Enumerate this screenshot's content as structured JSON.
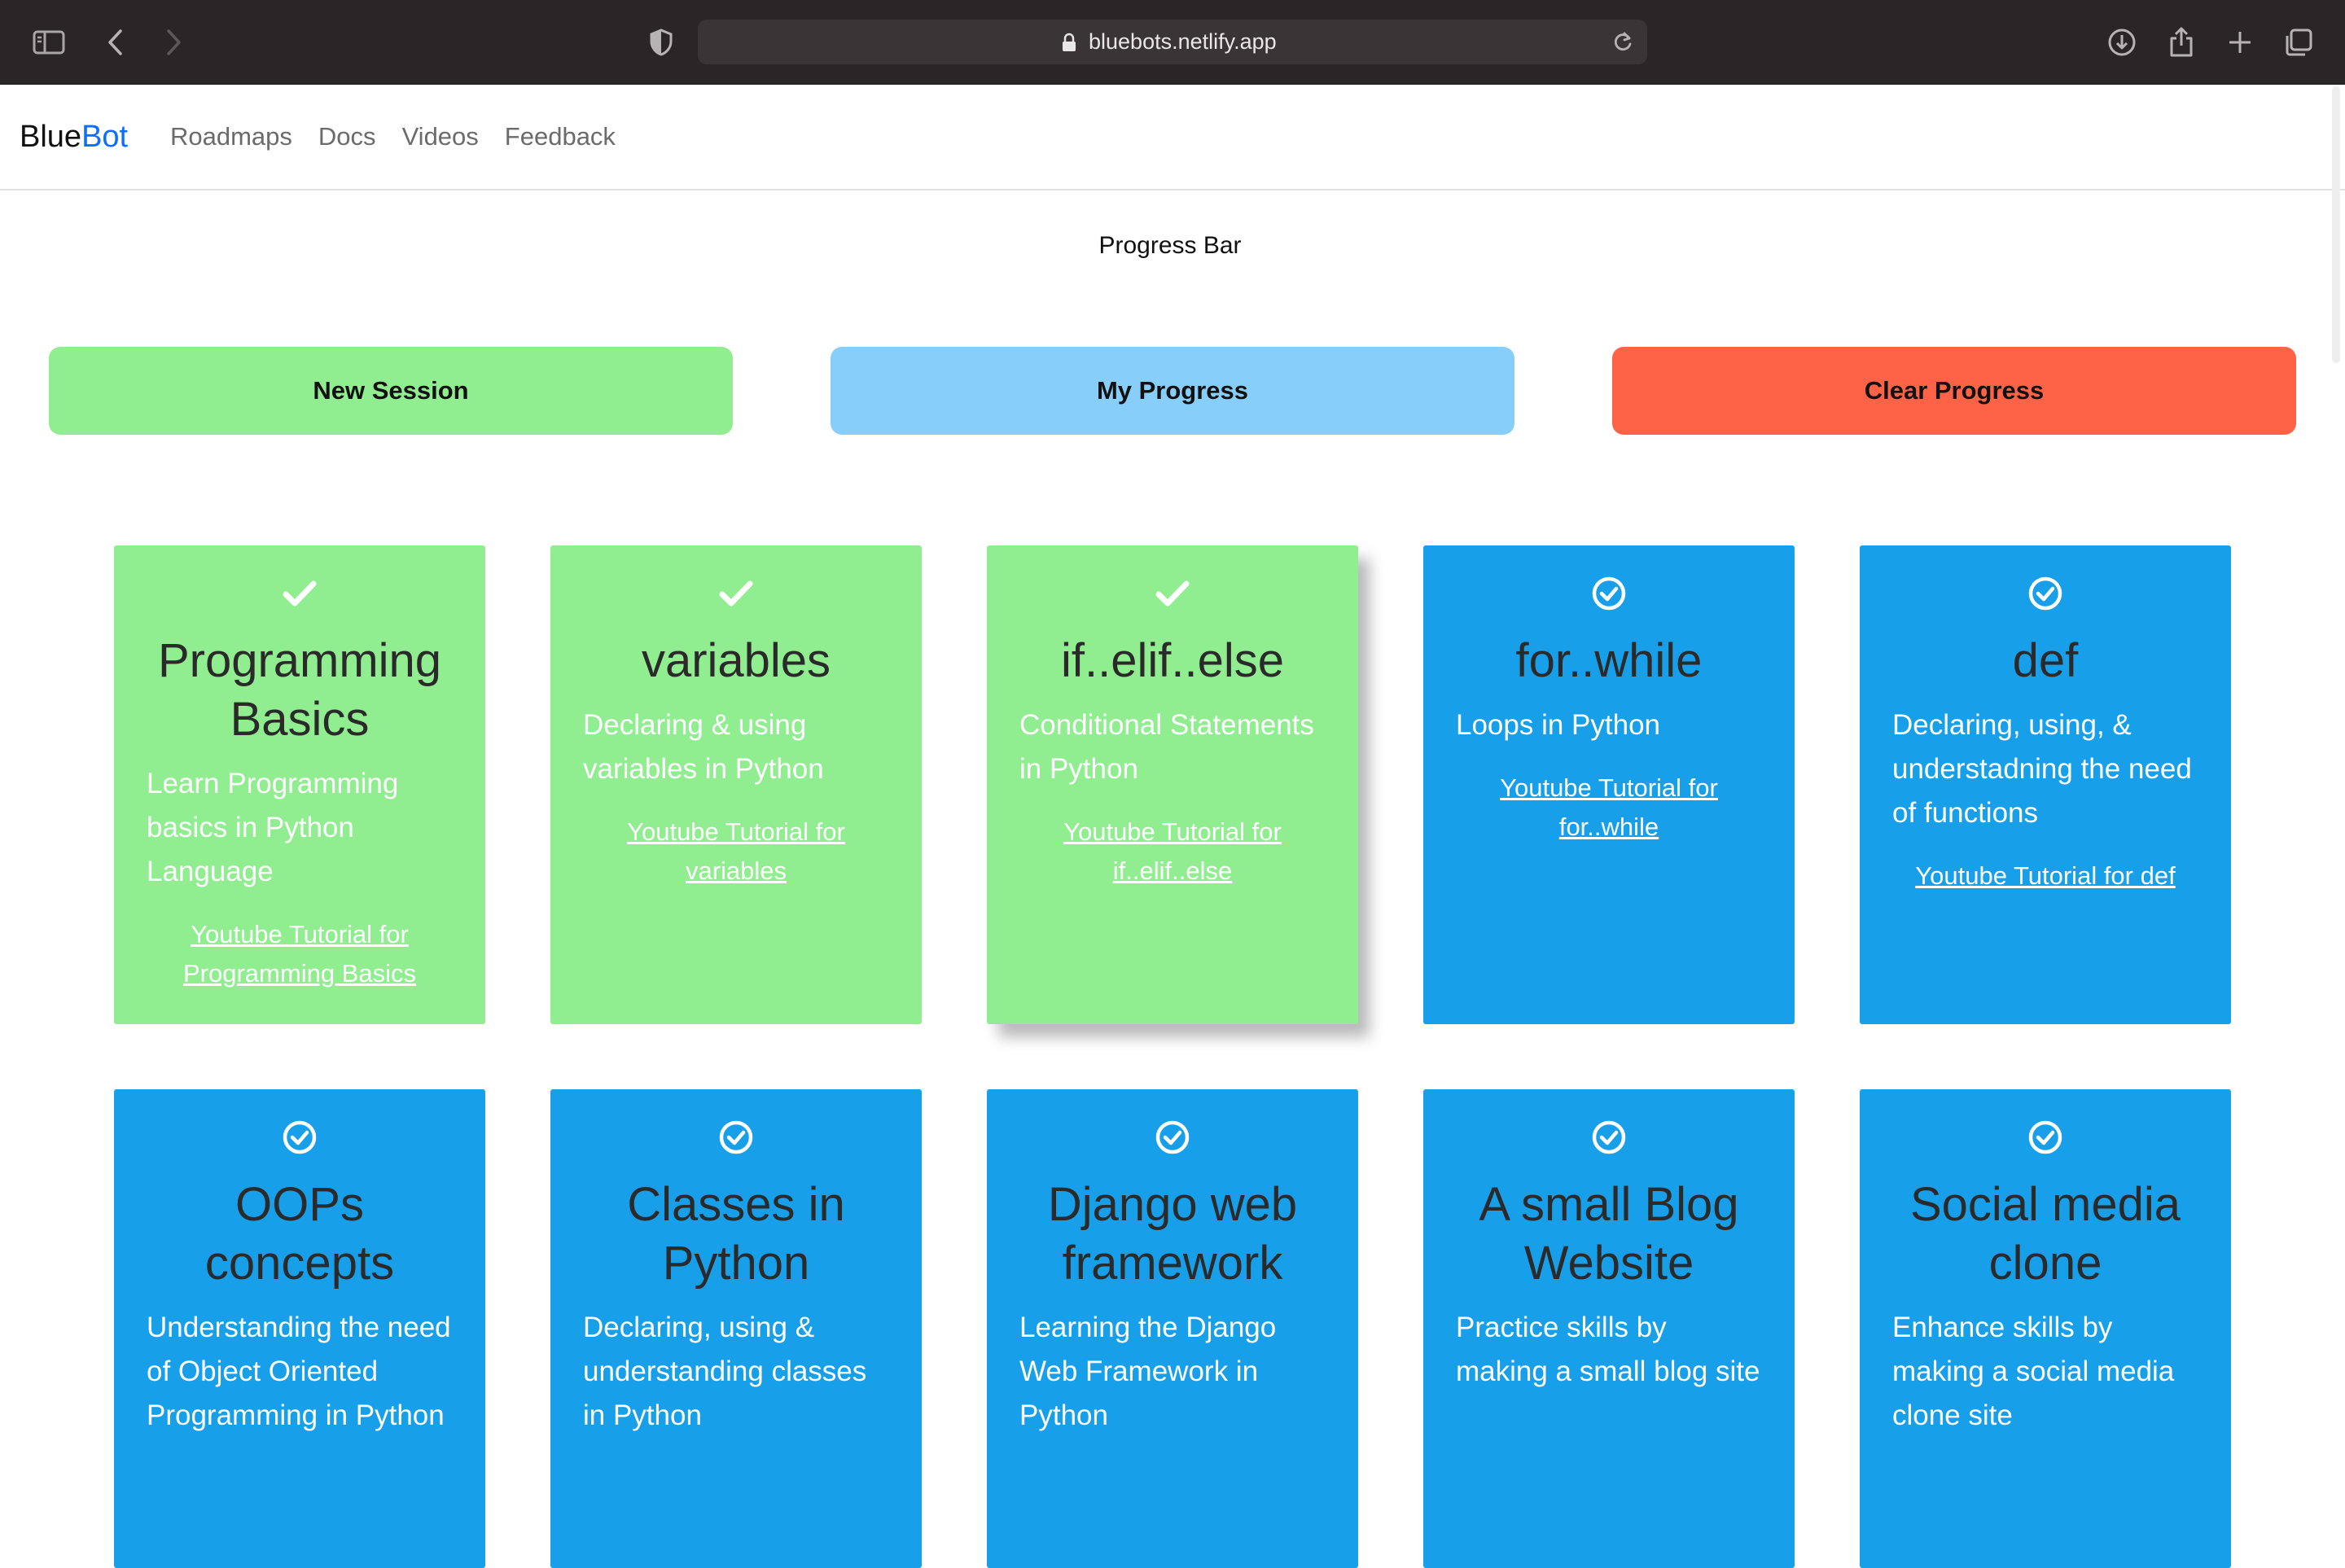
{
  "browser": {
    "url": "bluebots.netlify.app"
  },
  "nav": {
    "brand_part1": "Blue",
    "brand_part2": "Bot",
    "links": [
      "Roadmaps",
      "Docs",
      "Videos",
      "Feedback"
    ]
  },
  "progress": {
    "label": "Progress Bar",
    "buttons": {
      "new_session": "New Session",
      "my_progress": "My Progress",
      "clear_progress": "Clear Progress"
    }
  },
  "colors": {
    "completed": "#90ee90",
    "pending": "#179fea",
    "my_progress": "#87cefa",
    "clear": "#ff6347",
    "brand_accent": "#0d6efd"
  },
  "cards": [
    {
      "title": "Programming Basics",
      "desc": "Learn Programming basics in Python Language",
      "link": "Youtube Tutorial for Programming Basics",
      "status": "completed",
      "icon": "check-icon"
    },
    {
      "title": "variables",
      "desc": "Declaring & using variables in Python",
      "link": "Youtube Tutorial for variables",
      "status": "completed",
      "icon": "check-icon"
    },
    {
      "title": "if..elif..else",
      "desc": "Conditional Statements in Python",
      "link": "Youtube Tutorial for if..elif..else",
      "status": "completed",
      "icon": "check-icon"
    },
    {
      "title": "for..while",
      "desc": "Loops in Python",
      "link": "Youtube Tutorial for for..while",
      "status": "pending",
      "icon": "check-circle-icon"
    },
    {
      "title": "def",
      "desc": "Declaring, using, & understadning the need of functions",
      "link": "Youtube Tutorial for def",
      "status": "pending",
      "icon": "check-circle-icon"
    },
    {
      "title": "OOPs concepts",
      "desc": "Understanding the need of Object Oriented Programming in Python",
      "link": "",
      "status": "pending",
      "icon": "check-circle-icon"
    },
    {
      "title": "Classes in Python",
      "desc": "Declaring, using & understanding classes in Python",
      "link": "",
      "status": "pending",
      "icon": "check-circle-icon"
    },
    {
      "title": "Django web framework",
      "desc": "Learning the Django Web Framework in Python",
      "link": "",
      "status": "pending",
      "icon": "check-circle-icon"
    },
    {
      "title": "A small Blog Website",
      "desc": "Practice skills by making a small blog site",
      "link": "",
      "status": "pending",
      "icon": "check-circle-icon"
    },
    {
      "title": "Social media clone",
      "desc": "Enhance skills by making a social media clone site",
      "link": "",
      "status": "pending",
      "icon": "check-circle-icon"
    }
  ]
}
